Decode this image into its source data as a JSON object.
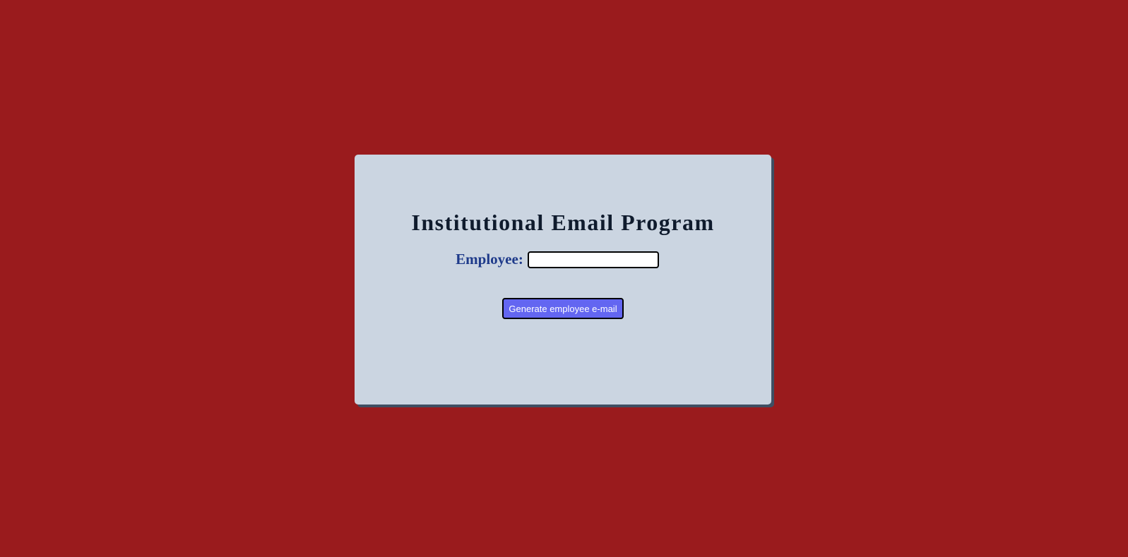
{
  "page": {
    "background_color": "#9a1b1d"
  },
  "card": {
    "background_color": "#cbd5e1",
    "title": "Institutional Email Program"
  },
  "form": {
    "employee_label": "Employee:",
    "employee_value": "",
    "employee_placeholder": "",
    "generate_button_label": "Generate employee e-mail",
    "button_color": "#6366f1"
  }
}
